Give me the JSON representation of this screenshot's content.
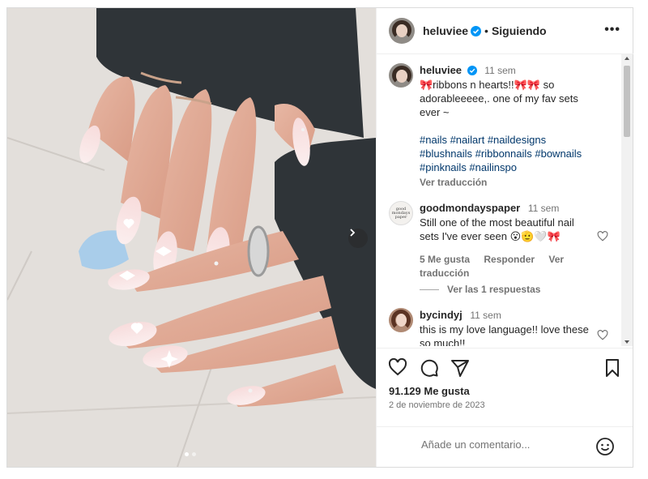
{
  "post": {
    "author": "heluviee",
    "follow_separator": "•",
    "follow_status": "Siguiendo",
    "more_label": "•••"
  },
  "caption": {
    "user": "heluviee",
    "time": "11 sem",
    "text": "🎀ribbons n hearts!!🎀🎀 so adorableeeee,. one of my fav sets ever ~",
    "hashtags": "#nails #nailart #naildesigns #blushnails #ribbonnails #bownails #pinknails #nailinspo",
    "translate": "Ver traducción"
  },
  "comments": [
    {
      "user": "goodmondayspaper",
      "avatar_text": "good mondays paper",
      "time": "11 sem",
      "text": "Still one of the most beautiful nail sets I've ever seen 😮🫡🤍🎀",
      "likes": "5 Me gusta",
      "reply": "Responder",
      "translate": "Ver traducción",
      "replies": "Ver las 1 respuestas"
    },
    {
      "user": "bycindyj",
      "time": "11 sem",
      "text": "this is my love language!! love these so much!!"
    }
  ],
  "stats": {
    "likes": "91.129 Me gusta",
    "date": "2 de noviembre de 2023"
  },
  "composer": {
    "placeholder": "Añade un comentario..."
  },
  "carousel": {
    "slide_count": 2,
    "active_slide": 1
  },
  "colors": {
    "verified": "#0095f6",
    "hashtag": "#00376b",
    "muted": "#737373"
  },
  "icons": [
    "heart-icon",
    "comment-icon",
    "share-icon",
    "bookmark-icon",
    "emoji-icon",
    "verified-icon",
    "chevron-right-icon",
    "more-icon"
  ]
}
